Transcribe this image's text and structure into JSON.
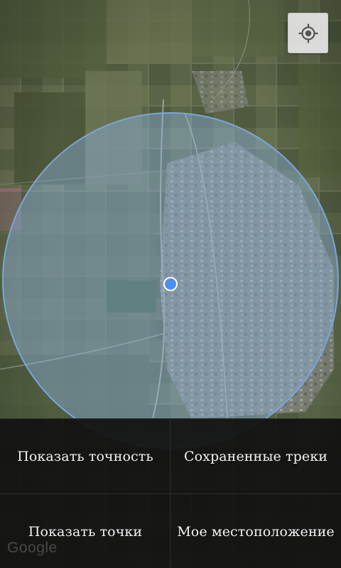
{
  "map": {
    "type": "satellite",
    "location_marker_color": "#4a8ff0",
    "accuracy_circle_color": "#8fb7e6"
  },
  "controls": {
    "my_location_icon": "crosshair-location-icon"
  },
  "menu": {
    "items": [
      {
        "label": "Показать точность"
      },
      {
        "label": "Сохраненные треки"
      },
      {
        "label": "Показать точки"
      },
      {
        "label": "Мое местоположение"
      }
    ]
  },
  "attribution": {
    "logo_text": "Google"
  }
}
